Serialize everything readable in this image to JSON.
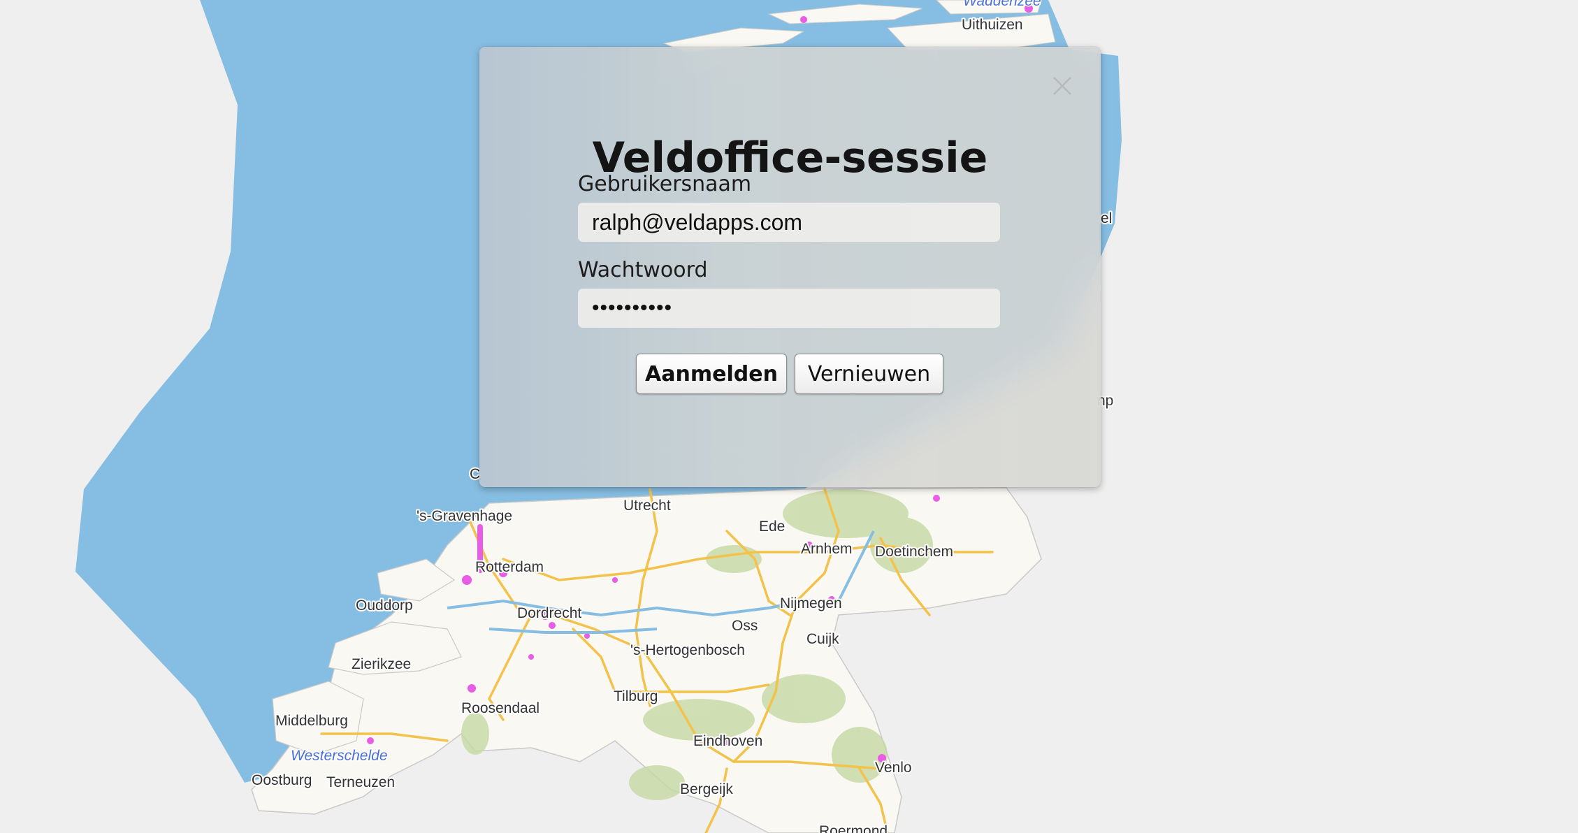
{
  "dialog": {
    "title": "Veldoffice-sessie",
    "username_label": "Gebruikersnaam",
    "username_value": "ralph@veldapps.com",
    "password_label": "Wachtwoord",
    "password_value": "••••••••••",
    "login_button": "Aanmelden",
    "renew_button": "Vernieuwen",
    "close_icon": "close-icon"
  },
  "map": {
    "cities": {
      "uithuizen": "Uithuizen",
      "den_haag": "'s-Gravenhage",
      "utrecht": "Utrecht",
      "ede": "Ede",
      "arnhem": "Arnhem",
      "doetinchem": "Doetinchem",
      "rotterdam": "Rotterdam",
      "ouddorp": "Ouddorp",
      "dordrecht": "Dordrecht",
      "nijmegen": "Nijmegen",
      "oss": "Oss",
      "cuijk": "Cuijk",
      "den_bosch": "'s-Hertogenbosch",
      "zierikzee": "Zierikzee",
      "tilburg": "Tilburg",
      "roosendaal": "Roosendaal",
      "middelburg": "Middelburg",
      "eindhoven": "Eindhoven",
      "oostburg": "Oostburg",
      "terneuzen": "Terneuzen",
      "venlo": "Venlo",
      "bergeijk": "Bergeijk",
      "roermond": "Roermond",
      "partial_el": "el",
      "partial_np": "np",
      "partial_c": "C"
    },
    "water": {
      "westerschelde": "Westerschelde",
      "waddenzee": "Waddenzee"
    },
    "colors": {
      "sea": "#86bde2",
      "background": "#efefef",
      "land": "#f9f8f3",
      "road_major": "#f2c24b",
      "urban": "#e95ce6",
      "forest": "#c6d9a4"
    }
  }
}
